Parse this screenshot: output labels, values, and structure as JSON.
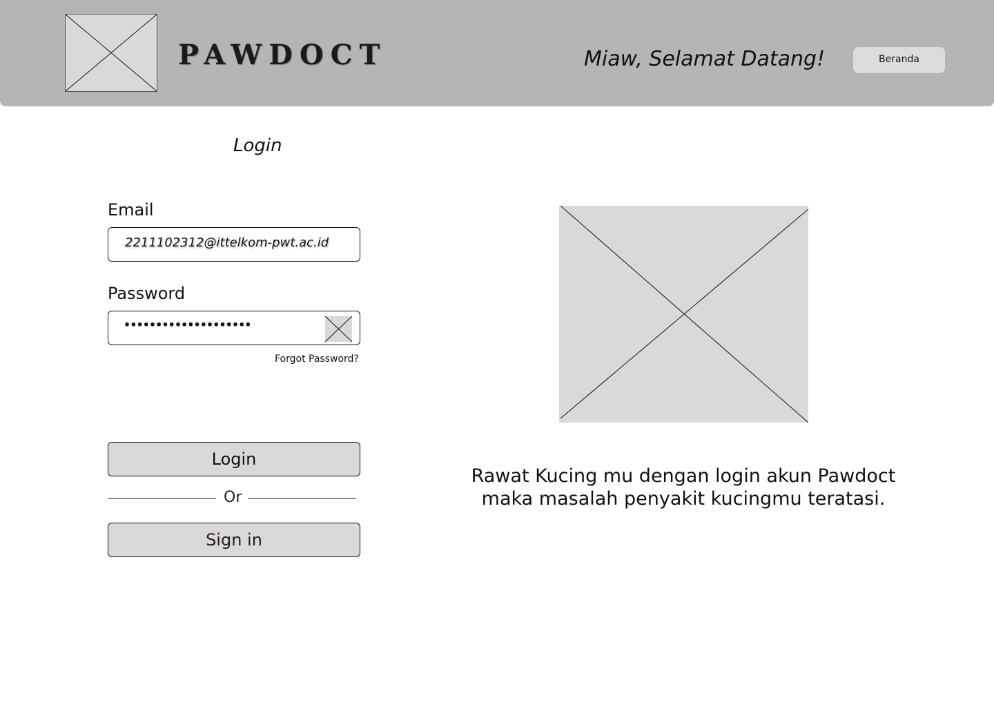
{
  "header": {
    "brand": "PAWDOCT",
    "logo_icon": "image-placeholder-icon",
    "welcome": "Miaw, Selamat Datang!",
    "nav_button": "Beranda"
  },
  "login_form": {
    "title": "Login",
    "email_label": "Email",
    "email_value": "2211102312@ittelkom-pwt.ac.id",
    "password_label": "Password",
    "password_masked": "••••••••••••••••••••",
    "password_toggle_icon": "image-placeholder-icon",
    "forgot_password": "Forgot Password?",
    "login_button": "Login",
    "divider_text": "Or",
    "signin_button": "Sign in"
  },
  "hero": {
    "image_icon": "image-placeholder-icon",
    "tagline_line1": "Rawat Kucing mu dengan login akun Pawdoct",
    "tagline_line2": "maka masalah penyakit kucingmu teratasi."
  },
  "colors": {
    "header_bg": "#b5b5b5",
    "placeholder_bg": "#d9d9d9",
    "button_bg": "#d9d9d9"
  }
}
